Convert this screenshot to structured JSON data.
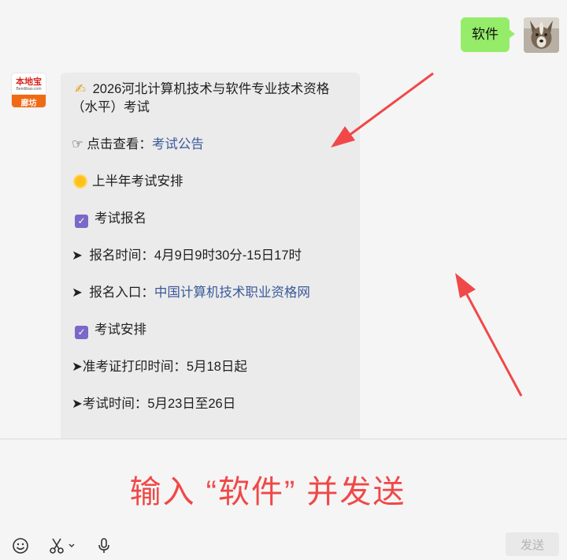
{
  "outgoing": {
    "text": "软件"
  },
  "bot": {
    "logo_top": "本地宝",
    "logo_sub": "Bendibao.com",
    "logo_city": "廊坊"
  },
  "message": {
    "title": "2026河北计算机技术与软件专业技术资格（水平）考试",
    "view_prefix": "点击查看：",
    "view_link": "考试公告",
    "schedule_header": "上半年考试安排",
    "registration_header": "考试报名",
    "reg_time": "报名时间：4月9日9时30分-15日17时",
    "reg_entry_prefix": "报名入口：",
    "reg_entry_link": "中国计算机技术职业资格网",
    "exam_header": "考试安排",
    "admit_card": "准考证打印时间：5月18日起",
    "exam_time": "考试时间：5月23日至26日"
  },
  "input": {
    "instruction": "输入 “软件” 并发送",
    "send_label": "发送"
  },
  "icons": {
    "emoji": "emoji-icon",
    "scissors": "scissors-icon",
    "mic": "microphone-icon"
  },
  "colors": {
    "outgoing_bubble": "#95ec69",
    "incoming_bubble": "#ebebeb",
    "link": "#3a5a9a",
    "annotation_red": "#f04848"
  }
}
